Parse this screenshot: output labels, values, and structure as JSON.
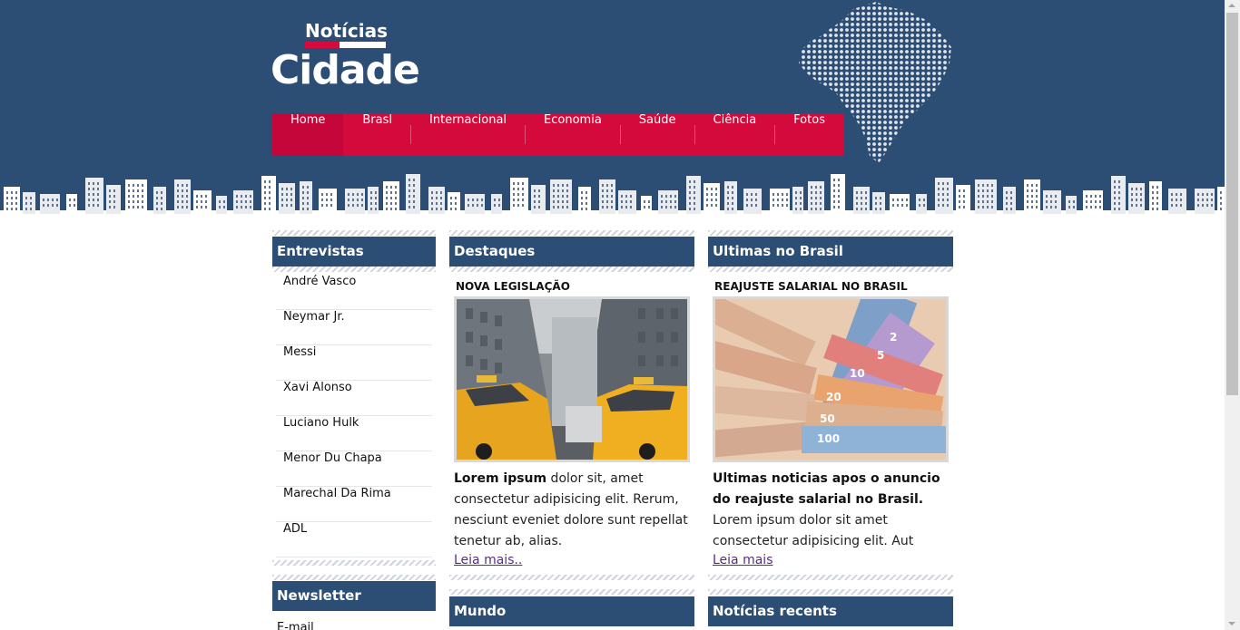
{
  "logo": {
    "line1": "Notícias",
    "line2": "Cidade"
  },
  "nav": {
    "items": [
      {
        "label": "Home",
        "active": true
      },
      {
        "label": "Brasl",
        "active": false
      },
      {
        "label": "Internacional",
        "active": false
      },
      {
        "label": "Economia",
        "active": false
      },
      {
        "label": "Saúde",
        "active": false
      },
      {
        "label": "Ciência",
        "active": false
      },
      {
        "label": "Fotos",
        "active": false
      }
    ]
  },
  "interviews": {
    "title": "Entrevistas",
    "items": [
      "André Vasco",
      "Neymar Jr.",
      "Messi",
      "Xavi Alonso",
      "Luciano Hulk",
      "Menor Du Chapa",
      "Marechal Da Rima",
      "ADL"
    ]
  },
  "newsletter": {
    "title": "Newsletter",
    "label_partial": "E-mail"
  },
  "highlights": {
    "title": "Destaques",
    "headline": "NOVA LEGISLAÇÃO",
    "lead": "Lorem ipsum",
    "body": " dolor sit, amet consectetur adipisicing elit. Rerum, nesciunt eveniet dolore sunt repellat tenetur ab, alias.",
    "more": "Leia mais.."
  },
  "brazil": {
    "title": "Ultimas no Brasil",
    "headline": "REAJUSTE SALARIAL NO BRASIL",
    "lead": "Ultimas noticias apos o anuncio do reajuste salarial no Brasil.",
    "body": " Lorem ipsum dolor sit amet consectetur adipisicing elit. Aut",
    "more": "Leia mais"
  },
  "world": {
    "title": "Mundo"
  },
  "recent": {
    "title": "Notícias recents"
  },
  "colors": {
    "header": "#2d4e74",
    "nav": "#d40a3d",
    "link": "#5a2b88"
  },
  "icons": {
    "map": "brazil-map-dots",
    "skyline": "city-skyline"
  }
}
